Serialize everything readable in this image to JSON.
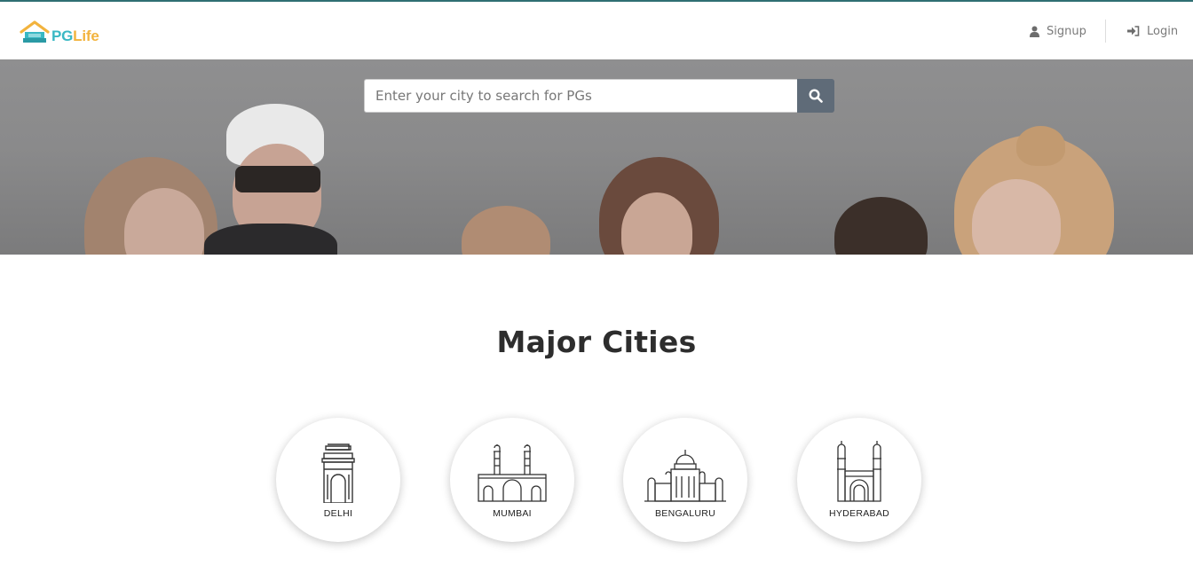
{
  "brand": {
    "pg": "PG",
    "life": "Life"
  },
  "nav": {
    "signup": "Signup",
    "login": "Login"
  },
  "search": {
    "placeholder": "Enter your city to search for PGs",
    "value": ""
  },
  "section": {
    "title": "Major Cities"
  },
  "cities": [
    {
      "name": "DELHI",
      "icon": "india-gate-icon"
    },
    {
      "name": "MUMBAI",
      "icon": "gateway-of-india-icon"
    },
    {
      "name": "BENGALURU",
      "icon": "vidhana-soudha-icon"
    },
    {
      "name": "HYDERABAD",
      "icon": "charminar-icon"
    }
  ],
  "colors": {
    "brand_teal": "#39b8c4",
    "brand_yellow": "#f2b33d",
    "search_button": "#5f6b78",
    "top_line": "#2f6f73"
  }
}
